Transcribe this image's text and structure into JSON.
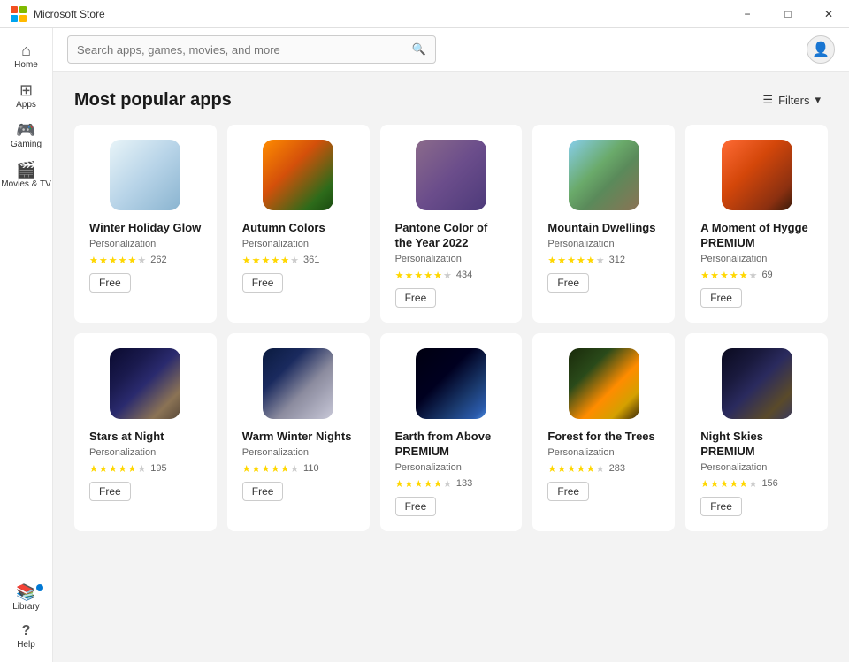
{
  "titlebar": {
    "title": "Microsoft Store",
    "minimize_label": "−",
    "maximize_label": "□",
    "close_label": "✕"
  },
  "search": {
    "placeholder": "Search apps, games, movies, and more"
  },
  "sidebar": {
    "items": [
      {
        "id": "home",
        "label": "Home",
        "icon": "⌂"
      },
      {
        "id": "apps",
        "label": "Apps",
        "icon": "⊞"
      },
      {
        "id": "gaming",
        "label": "Gaming",
        "icon": "🎮"
      },
      {
        "id": "movies",
        "label": "Movies & TV",
        "icon": "🎬"
      }
    ],
    "bottom_items": [
      {
        "id": "library",
        "label": "Library",
        "icon": "📚",
        "has_dot": true
      },
      {
        "id": "help",
        "label": "Help",
        "icon": "?"
      }
    ]
  },
  "page": {
    "title": "Most popular apps",
    "filters_label": "Filters"
  },
  "apps": [
    {
      "id": "winter-holiday-glow",
      "name": "Winter Holiday Glow",
      "category": "Personalization",
      "rating": 4.0,
      "rating_count": "262",
      "price": "Free",
      "icon_class": "icon-winter",
      "stars": [
        1,
        1,
        1,
        1,
        0.5,
        0
      ]
    },
    {
      "id": "autumn-colors",
      "name": "Autumn Colors",
      "category": "Personalization",
      "rating": 4.5,
      "rating_count": "361",
      "price": "Free",
      "icon_class": "icon-autumn",
      "stars": [
        1,
        1,
        1,
        1,
        1,
        0
      ]
    },
    {
      "id": "pantone-color",
      "name": "Pantone Color of the Year 2022",
      "category": "Personalization",
      "rating": 4.0,
      "rating_count": "434",
      "price": "Free",
      "icon_class": "icon-pantone",
      "stars": [
        1,
        1,
        1,
        1,
        0.5,
        0
      ]
    },
    {
      "id": "mountain-dwellings",
      "name": "Mountain Dwellings",
      "category": "Personalization",
      "rating": 4.5,
      "rating_count": "312",
      "price": "Free",
      "icon_class": "icon-mountain",
      "stars": [
        1,
        1,
        1,
        1,
        0.5,
        0
      ]
    },
    {
      "id": "moment-hygge",
      "name": "A Moment of Hygge PREMIUM",
      "category": "Personalization",
      "rating": 4.5,
      "rating_count": "69",
      "price": "Free",
      "icon_class": "icon-hygge",
      "stars": [
        1,
        1,
        1,
        1,
        0.5,
        0
      ]
    },
    {
      "id": "stars-at-night",
      "name": "Stars at Night",
      "category": "Personalization",
      "rating": 4.0,
      "rating_count": "195",
      "price": "Free",
      "icon_class": "icon-stars",
      "stars": [
        1,
        1,
        1,
        1,
        0.5,
        0
      ]
    },
    {
      "id": "warm-winter-nights",
      "name": "Warm Winter Nights",
      "category": "Personalization",
      "rating": 4.0,
      "rating_count": "110",
      "price": "Free",
      "icon_class": "icon-warm-winter",
      "stars": [
        1,
        1,
        1,
        1,
        0.5,
        0
      ]
    },
    {
      "id": "earth-from-above",
      "name": "Earth from Above PREMIUM",
      "category": "Personalization",
      "rating": 4.0,
      "rating_count": "133",
      "price": "Free",
      "icon_class": "icon-earth",
      "stars": [
        1,
        1,
        1,
        1,
        0.5,
        0
      ]
    },
    {
      "id": "forest-for-trees",
      "name": "Forest for the Trees",
      "category": "Personalization",
      "rating": 4.5,
      "rating_count": "283",
      "price": "Free",
      "icon_class": "icon-forest",
      "stars": [
        1,
        1,
        1,
        1,
        1,
        0
      ]
    },
    {
      "id": "night-skies",
      "name": "Night Skies PREMIUM",
      "category": "Personalization",
      "rating": 4.5,
      "rating_count": "156",
      "price": "Free",
      "icon_class": "icon-night-skies",
      "stars": [
        1,
        1,
        1,
        1,
        0.5,
        0
      ]
    }
  ]
}
